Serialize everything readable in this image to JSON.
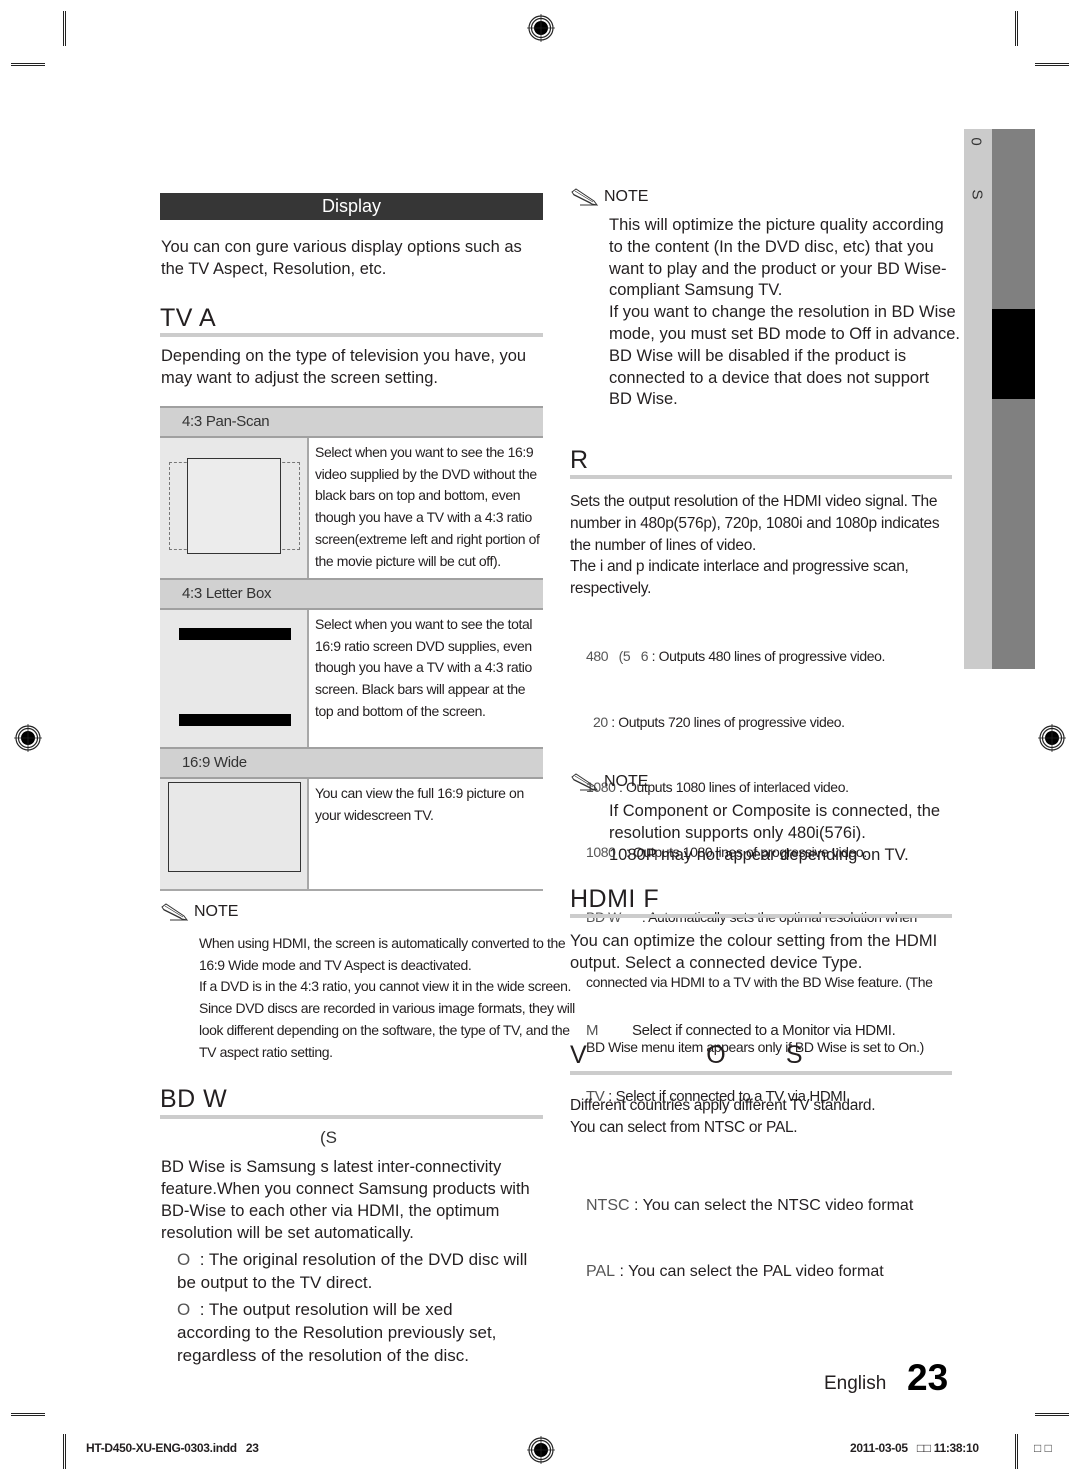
{
  "section": {
    "title": "Display"
  },
  "intro": {
    "lines": [
      "You can con    gure various display options such as",
      "the TV Aspect, Resolution, etc."
    ]
  },
  "tv_aspect": {
    "heading": "TV A",
    "lines": [
      "Depending on the type of television you have, you",
      "may want to adjust the screen setting."
    ],
    "options": [
      {
        "label": "4:3 Pan-Scan",
        "icon": "pan-scan-icon",
        "desc": [
          "Select when you want to see the 16:9",
          "video supplied by the DVD without the",
          "black bars on top and bottom, even",
          "though you have a TV with a 4:3 ratio",
          "screen(extreme left and right portion of",
          "the movie picture will be cut off)."
        ]
      },
      {
        "label": "4:3 Letter Box",
        "icon": "letter-box-icon",
        "desc": [
          "Select when you want to see the total",
          "16:9 ratio screen DVD supplies, even",
          "though you have a TV with a 4:3 ratio",
          "screen. Black bars will appear at the",
          "top and bottom of the screen."
        ]
      },
      {
        "label": "16:9 Wide",
        "icon": "wide-screen-icon",
        "desc": [
          "You can view the full 16:9 picture on",
          "your widescreen TV."
        ]
      }
    ],
    "note": {
      "label": "NOTE",
      "lines": [
        "When using HDMI, the screen is automatically converted to the",
        "16:9 Wide mode and TV Aspect is deactivated.",
        "If a DVD is in the 4:3 ratio, you cannot view it in the wide screen.",
        "Since DVD discs are recorded in various image formats, they will",
        "look different depending on the software, the type of TV, and the",
        "TV aspect ratio setting."
      ]
    }
  },
  "bd_wise": {
    "heading": "BD W",
    "subheading": "(S",
    "lines": [
      "BD Wise is Samsung    s latest inter-connectivity",
      "feature.When you connect Samsung products with",
      "BD-Wise to each other via HDMI, the optimum",
      "resolution will be set automatically."
    ],
    "options": [
      {
        "term": "O",
        "lines": [
          ": The original resolution of the DVD disc will",
          "be output to the TV direct."
        ]
      },
      {
        "term": "O",
        "lines": [
          ": The output resolution will be     xed",
          "according to the Resolution previously set,",
          "regardless of the resolution of the disc."
        ]
      }
    ],
    "note": {
      "label": "NOTE",
      "lines": [
        "This will optimize the picture quality according",
        "to the content (In the DVD disc, etc) that you",
        "want to play and the product or your BD Wise-",
        "compliant Samsung TV.",
        "If you want to change the resolution in BD Wise",
        "mode, you must set BD mode to Off in advance.",
        "BD Wise will be disabled if the product is",
        "connected to a device that does not support",
        "BD Wise."
      ]
    }
  },
  "resolution": {
    "heading": "R",
    "lines": [
      "Sets the output resolution of the HDMI video signal. The",
      "number in 480p(576p), 720p, 1080i and 1080p indicates",
      "the number of lines of video.",
      "The i and p indicate interlace and progressive scan,",
      "respectively."
    ],
    "options": [
      {
        "term": "480   (5   6",
        "text": " : Outputs 480 lines of progressive video."
      },
      {
        "term": "  20",
        "text": " : Outputs 720 lines of progressive video."
      },
      {
        "term": "1080",
        "text": " : Outputs 1080 lines of interlaced video."
      },
      {
        "term": "1080  ",
        "text": " : Outputs 1080 lines of progressive video."
      },
      {
        "term": "BD W     ",
        "text": " : Automatically sets the optimal resolution when"
      }
    ],
    "bdwise_cont": [
      "connected via HDMI to a TV with the BD Wise feature. (The",
      "BD Wise menu item appears only if BD Wise is set to On.)"
    ],
    "note": {
      "label": "NOTE",
      "lines": [
        "If Component or Composite is connected, the",
        "resolution supports only 480i(576i).",
        "1080P may not appear depending on TV."
      ]
    }
  },
  "hdmi_format": {
    "heading": "HDMI F",
    "lines": [
      "You can optimize the colour setting from the HDMI",
      "output. Select a connected device Type."
    ],
    "options": [
      {
        "term": "M         ",
        "text": "Select if connected to a Monitor via HDMI."
      },
      {
        "term": "TV",
        "text": " : Select if connected to a TV via HDMI."
      }
    ]
  },
  "video_output": {
    "heading": "V                O        S",
    "lines": [
      "Different countries apply different TV standard.",
      "You can select from NTSC or PAL."
    ],
    "options": [
      {
        "term": "NTSC",
        "text": " : You can select the NTSC video format"
      },
      {
        "term": "PAL",
        "text": " : You can select the PAL video format"
      }
    ]
  },
  "side_tab": {
    "labels": [
      "0",
      "S"
    ]
  },
  "page": {
    "language": "English",
    "number": "23"
  },
  "footer": {
    "file": "HT-D450-XU-ENG-0303.indd   23",
    "timestamp": "2011-03-05   □□ 11:38:10",
    "marks": "□ □"
  }
}
